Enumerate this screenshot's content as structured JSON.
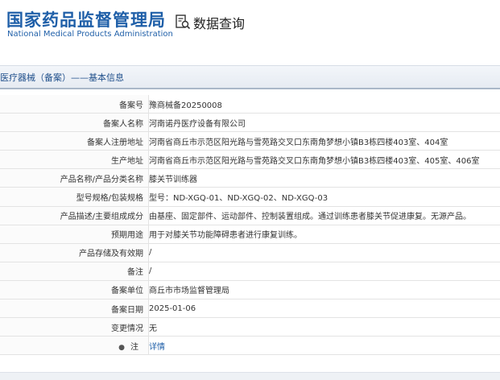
{
  "header": {
    "logo_cn": "国家药品监督管理局",
    "logo_en": "National Medical Products Administration",
    "query_title": "数据查询",
    "brand_color": "#1f5fa8"
  },
  "section": {
    "title": "医疗器械（备案）——基本信息"
  },
  "rows": [
    {
      "label": "备案号",
      "value": "豫商械备20250008"
    },
    {
      "label": "备案人名称",
      "value": "河南诺丹医疗设备有限公司"
    },
    {
      "label": "备案人注册地址",
      "value": "河南省商丘市示范区阳光路与雪苑路交叉口东南角梦想小镇B3栋四楼403室、404室"
    },
    {
      "label": "生产地址",
      "value": "河南省商丘市示范区阳光路与雪苑路交叉口东南角梦想小镇B3栋四楼403室、405室、406室"
    },
    {
      "label": "产品名称/产品分类名称",
      "value": "膝关节训练器"
    },
    {
      "label": "型号规格/包装规格",
      "value": "型号：ND-XGQ-01、ND-XGQ-02、ND-XGQ-03"
    },
    {
      "label": "产品描述/主要组成成分",
      "value": "由基座、固定部件、运动部件、控制装置组成。通过训练患者膝关节促进康复。无源产品。"
    },
    {
      "label": "预期用途",
      "value": "用于对膝关节功能障碍患者进行康复训练。"
    },
    {
      "label": "产品存储及有效期",
      "value": "/"
    },
    {
      "label": "备注",
      "value": "/"
    },
    {
      "label": "备案单位",
      "value": "商丘市市场监督管理局"
    },
    {
      "label": "备案日期",
      "value": "2025-01-06"
    },
    {
      "label": "变更情况",
      "value": "无"
    },
    {
      "label": "注",
      "value": "详情"
    }
  ]
}
